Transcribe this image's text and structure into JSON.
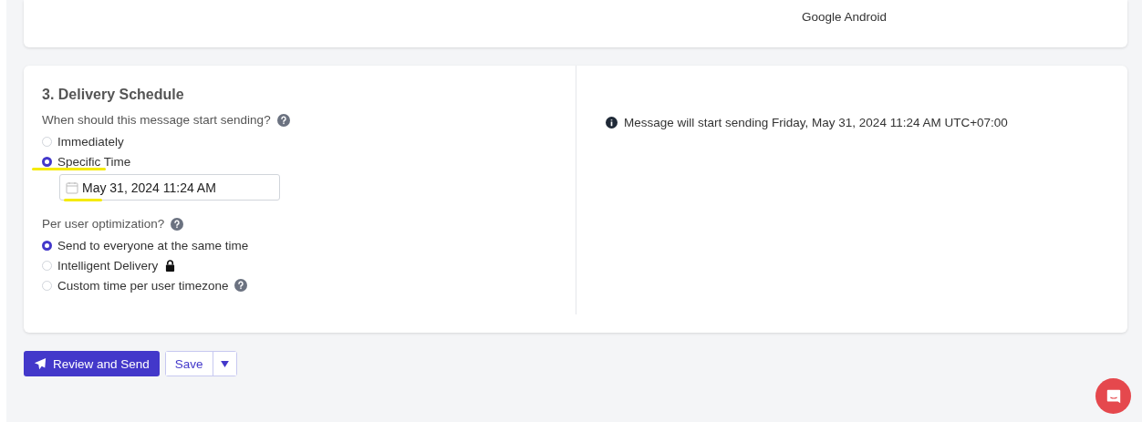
{
  "top_card": {
    "platform": "Google Android"
  },
  "schedule": {
    "title": "3. Delivery Schedule",
    "start_question": "When should this message start sending?",
    "start_options": [
      {
        "label": "Immediately",
        "selected": false
      },
      {
        "label": "Specific Time",
        "selected": true
      }
    ],
    "datetime_value": "May 31, 2024 11:24 AM",
    "optimization_question": "Per user optimization?",
    "optimization_options": [
      {
        "label": "Send to everyone at the same time",
        "selected": true,
        "locked": false,
        "help": false
      },
      {
        "label": "Intelligent Delivery",
        "selected": false,
        "locked": true,
        "help": false
      },
      {
        "label": "Custom time per user timezone",
        "selected": false,
        "locked": false,
        "help": true
      }
    ],
    "notice": "Message will start sending Friday, May 31, 2024 11:24 AM UTC+07:00"
  },
  "actions": {
    "primary": "Review and Send",
    "save": "Save"
  }
}
